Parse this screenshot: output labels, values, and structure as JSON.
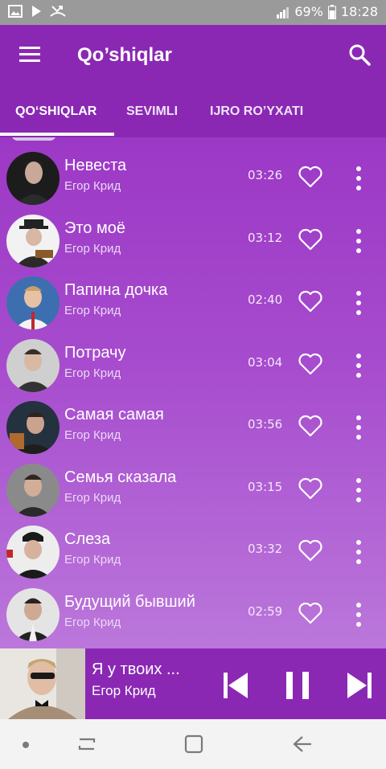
{
  "status_bar": {
    "battery": "69%",
    "time": "18:28",
    "icons": [
      "gallery-icon",
      "play-icon",
      "missed-call-icon",
      "signal-icon",
      "battery-icon"
    ]
  },
  "app_bar": {
    "title": "Qo’shiqlar"
  },
  "tabs": [
    {
      "label": "QO‘SHIQLAR",
      "active": true
    },
    {
      "label": "SEVIMLI",
      "active": false
    },
    {
      "label": "IJRO RO’YXATI",
      "active": false
    }
  ],
  "songs": [
    {
      "title": "Невеста",
      "artist": "Егор Крид",
      "duration": "03:26"
    },
    {
      "title": "Это моё",
      "artist": "Егор Крид",
      "duration": "03:12"
    },
    {
      "title": "Папина дочка",
      "artist": "Егор Крид",
      "duration": "02:40"
    },
    {
      "title": "Потрачу",
      "artist": "Егор Крид",
      "duration": "03:04"
    },
    {
      "title": "Самая самая",
      "artist": "Егор Крид",
      "duration": "03:56"
    },
    {
      "title": "Семья сказала",
      "artist": "Егор Крид",
      "duration": "03:15"
    },
    {
      "title": "Слеза",
      "artist": "Егор Крид",
      "duration": "03:32"
    },
    {
      "title": "Будущий бывший",
      "artist": "Егор Крид",
      "duration": "02:59"
    }
  ],
  "now_playing": {
    "title": "Я у твоих ...",
    "artist": "Егор Крид"
  },
  "colors": {
    "app_bar": "#8a28b4",
    "list_top": "#9c38c6",
    "list_bottom": "#bb77db",
    "nav_bar": "#f3f3f3"
  }
}
